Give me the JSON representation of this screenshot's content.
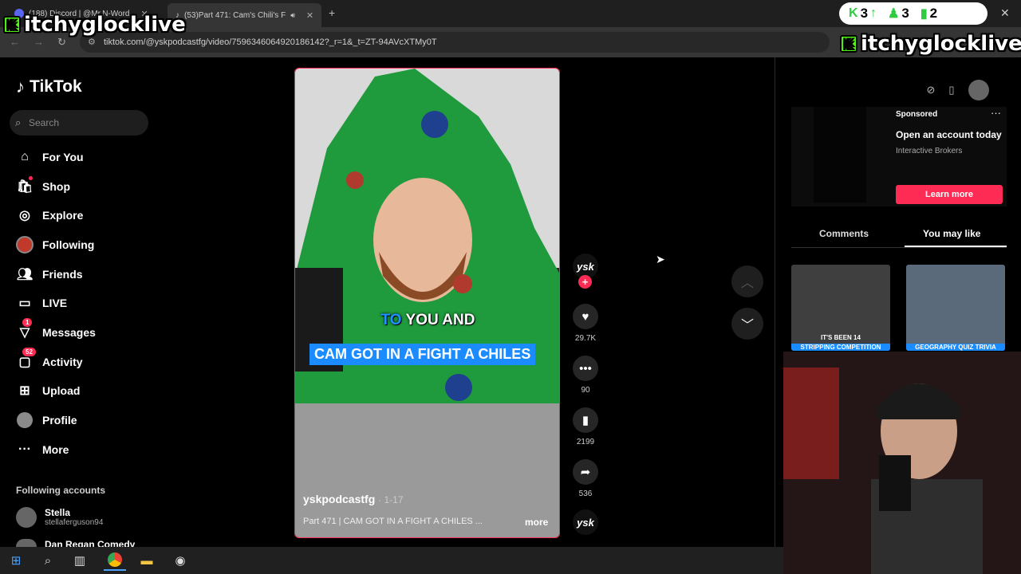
{
  "browser": {
    "tabs": [
      {
        "title": "(188) Discord | @Mr.N-Word",
        "badge": "188"
      },
      {
        "title": "(53)Part 471: Cam's Chili's F",
        "active": true
      }
    ],
    "url": "tiktok.com/@yskpodcastfg/video/7596346064920186142?_r=1&_t=ZT-94AVcXTMy0T"
  },
  "overlay": {
    "brand_left": "itchyglocklive",
    "brand_right": "itchyglocklive",
    "stats": [
      "3",
      "3",
      "2"
    ]
  },
  "sidebar": {
    "logo": "TikTok",
    "search_placeholder": "Search",
    "nav": [
      {
        "label": "For You",
        "icon": "home-icon"
      },
      {
        "label": "Shop",
        "icon": "shop-icon"
      },
      {
        "label": "Explore",
        "icon": "compass-icon"
      },
      {
        "label": "Following",
        "icon": "following-avatar-icon"
      },
      {
        "label": "Friends",
        "icon": "friends-icon"
      },
      {
        "label": "LIVE",
        "icon": "live-icon"
      },
      {
        "label": "Messages",
        "icon": "messages-icon",
        "badge": "1"
      },
      {
        "label": "Activity",
        "icon": "activity-icon",
        "badge": "52"
      },
      {
        "label": "Upload",
        "icon": "upload-icon"
      },
      {
        "label": "Profile",
        "icon": "profile-avatar-icon"
      },
      {
        "label": "More",
        "icon": "more-icon"
      }
    ],
    "following_header": "Following accounts",
    "following": [
      {
        "name": "Stella",
        "handle": "stellaferguson94"
      },
      {
        "name": "Dan Regan Comedy"
      }
    ]
  },
  "video": {
    "caption_blue": "TO",
    "caption_white": "YOU AND",
    "caption_highlight": "CAM GOT IN A FIGHT A CHILES",
    "author": "yskpodcastfg",
    "date": "· 1-17",
    "description": "Part 471 | CAM GOT IN A FIGHT A CHILES ...",
    "more": "more",
    "avatar_text": "ysk"
  },
  "actions": {
    "likes": "29.7K",
    "comments": "90",
    "saves": "2199",
    "shares": "536"
  },
  "right_panel": {
    "sponsored": "Sponsored",
    "ad_title": "Open an account today",
    "ad_sub": "Interactive Brokers",
    "ad_cta": "Learn more",
    "tab_comments": "Comments",
    "tab_you_may_like": "You may like",
    "thumb1_label": "IT'S BEEN 14",
    "thumb1_sub": "STRIPPING COMPETITION",
    "thumb2_label": "GEOGRAPHY QUIZ TRIVIA"
  },
  "colors": {
    "accent": "#fe2c55",
    "caption_blue": "#1a8cff",
    "kick_green": "#53fc18"
  }
}
